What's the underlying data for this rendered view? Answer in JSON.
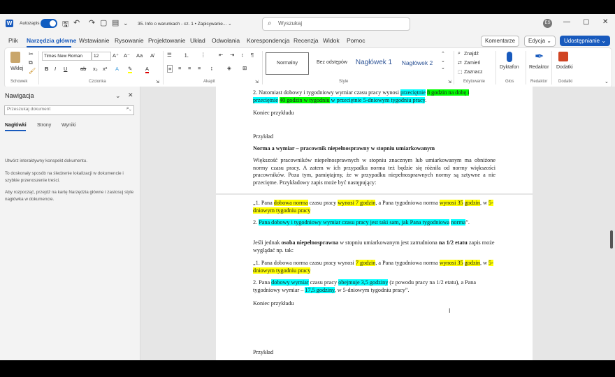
{
  "titlebar": {
    "autosave_label": "Autozapis",
    "doc_title": "35. Info o warunkach - cz. 1 • Zapisywanie... ⌄",
    "search_placeholder": "Wyszukaj",
    "avatar_initials": "ES"
  },
  "menu": {
    "items": [
      "Plik",
      "Narzędzia główne",
      "Wstawianie",
      "Rysowanie",
      "Projektowanie",
      "Układ",
      "Odwołania",
      "Korespondencja",
      "Recenzja",
      "Widok",
      "Pomoc"
    ],
    "comments": "Komentarze",
    "editing": "Edycja ⌄",
    "share": "Udostępnianie ⌄"
  },
  "ribbon": {
    "paste": "Wklej",
    "clipboard_label": "Schowek",
    "font_name": "Times New Roman",
    "font_size": "12",
    "font_label": "Czcionka",
    "paragraph_label": "Akapit",
    "styles": [
      "Normalny",
      "Bez odstępów",
      "Nagłówek 1",
      "Nagłówek 2"
    ],
    "styles_label": "Style",
    "find": "Znajdź",
    "replace": "Zamień",
    "select": "Zaznacz",
    "editing_label": "Edytowanie",
    "dictate": "Dyktafon",
    "voice_label": "Głos",
    "editor": "Redaktor",
    "editor_label": "Redaktor",
    "addins": "Dodatki",
    "addins_label": "Dodatki"
  },
  "nav": {
    "title": "Nawigacja",
    "search_placeholder": "Przeszukaj dokument",
    "tabs": [
      "Nagłówki",
      "Strony",
      "Wyniki"
    ],
    "text1": "Utwórz interaktywny konspekt dokumentu.",
    "text2": "To doskonały sposób na śledzenie lokalizacji w dokumencie i szybkie przenoszenie treści.",
    "text3": "Aby rozpocząć, przejdź na kartę Narzędzia główne i zastosuj style nagłówka w dokumencie."
  },
  "doc": {
    "p1_a": "2. Natomiast dobowy i tygodniowy wymiar czasu pracy wynosi ",
    "p1_b": "przeciętnie",
    "p1_c": "8 godzin na dobę i",
    "p1_d": "przeciętnie",
    "p1_e": "40 godzin w tygodniu",
    "p1_f": " w przeciętnie 5-dniowym tygodniu pracy",
    "p1_g": ".",
    "end1": "Koniec przykładu",
    "ex2": "Przykład",
    "heading": "Norma a wymiar – pracownik niepełnosprawny w stopniu umiarkowanym",
    "body": "Większość pracowników niepełnosprawnych w stopniu znacznym lub umiarkowanym ma obniżone normy czasu pracy. A zatem w ich przypadku norma też będzie się różniła od normy większości pracowników. Poza tym, pamiętajmy, że w przypadku niepełnosprawnych normy są sztywne a nie przeciętne. Przykładowy zapis może być następujący:",
    "q1_a": "„1. Pana ",
    "q1_b": "dobowa norma",
    "q1_c": " czasu pracy ",
    "q1_d": "wynosi 7 godzin",
    "q1_e": ", a Pana tygodniowa norma ",
    "q1_f": "wynosi 35",
    "q1_g": "godzin",
    "q1_h": ", w ",
    "q1_i": "5-dniowym tygodniu pracy",
    "q2_a": "2. ",
    "q2_b": "Pana dobowy i tygodniowy wymiar czasu pracy jest taki sam, jak Pana tygodniowa",
    "q2_c": "norma",
    "q2_d": "”.",
    "p_half_a": "Jeśli jednak ",
    "p_half_b": "osoba niepełnosprawna",
    "p_half_c": " w stopniu umiarkowanym jest zatrudniona ",
    "p_half_d": "na 1/2 etatu",
    "p_half_e": " zapis może wyglądać np. tak:",
    "r1_a": "„1. Pana dobowa norma czasu pracy wynosi ",
    "r1_b": "7 godzin",
    "r1_c": ", a Pana tygodniowa norma ",
    "r1_d": "wynosi 35",
    "r1_e": "godzin",
    "r1_f": ", w ",
    "r1_g": "5-dniowym tygodniu pracy",
    "r2_a": "2. Pana ",
    "r2_b": "dobowy wymiar",
    "r2_c": " czasu pracy ",
    "r2_d": "obejmuje 3,5 godziny",
    "r2_e": " (z powodu pracy na 1/2 etatu), a Pana tygodniowy wymiar – ",
    "r2_f": "17,5 godziny",
    "r2_g": ", w 5-dniowym tygodniu pracy”.",
    "end2": "Koniec przykładu",
    "ex3": "Przykład"
  },
  "colors": {
    "accent": "#185abd",
    "highlight_yellow": "#ffff00",
    "highlight_cyan": "#00ffff",
    "highlight_green": "#00ff00"
  }
}
